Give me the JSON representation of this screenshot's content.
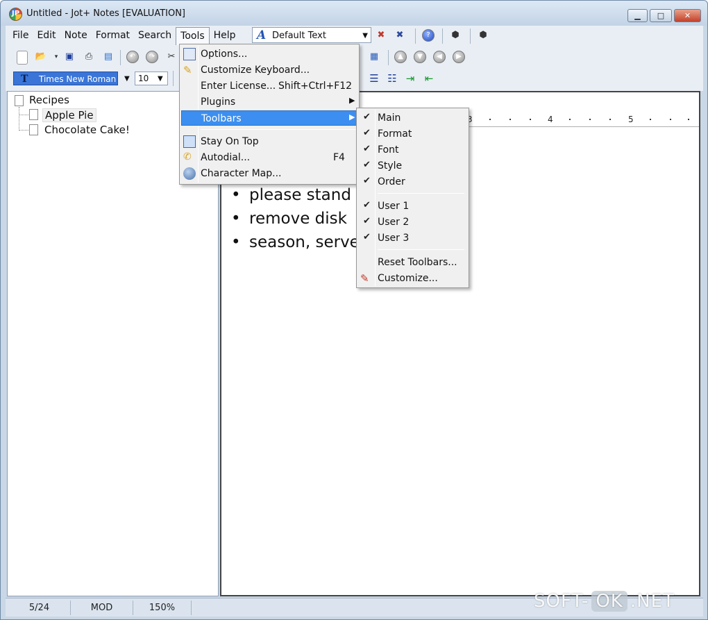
{
  "window": {
    "title": "Untitled - Jot+ Notes [EVALUATION]",
    "controls": {
      "minimize": "▁",
      "maximize": "□",
      "close": "✕"
    }
  },
  "menubar": {
    "items": [
      "File",
      "Edit",
      "Note",
      "Format",
      "Search",
      "Tools",
      "Help"
    ],
    "active": "Tools"
  },
  "style_combo": {
    "value": "Default Text"
  },
  "font_toolbar": {
    "font_name": "Times New Roman",
    "font_size": "10"
  },
  "tree": {
    "items": [
      {
        "label": "Recipes",
        "level": 0
      },
      {
        "label": "Apple Pie",
        "level": 1
      },
      {
        "label": "Chocolate Cake!",
        "level": 1
      }
    ]
  },
  "editor": {
    "ruler_numbers": [
      "3",
      "4",
      "5"
    ],
    "bullets": [
      "please stand by",
      "remove disk",
      "season, serve a"
    ]
  },
  "tools_menu": {
    "items": [
      {
        "label": "Options...",
        "shortcut": "",
        "icon": "options-icon"
      },
      {
        "label": "Customize Keyboard...",
        "shortcut": "",
        "icon": "keyboard-pen-icon"
      },
      {
        "label": "Enter License...",
        "shortcut": "Shift+Ctrl+F12",
        "icon": ""
      },
      {
        "label": "Plugins",
        "shortcut": "",
        "icon": "",
        "submenu": true
      },
      {
        "label": "Toolbars",
        "shortcut": "",
        "icon": "",
        "submenu": true,
        "highlighted": true
      },
      {
        "label": "Stay On Top",
        "shortcut": "",
        "icon": "window-stack-icon"
      },
      {
        "label": "Autodial...",
        "shortcut": "F4",
        "icon": "phone-icon"
      },
      {
        "label": "Character Map...",
        "shortcut": "",
        "icon": "character-map-icon"
      }
    ]
  },
  "toolbars_submenu": {
    "items": [
      {
        "label": "Main",
        "checked": true
      },
      {
        "label": "Format",
        "checked": true
      },
      {
        "label": "Font",
        "checked": true
      },
      {
        "label": "Style",
        "checked": true
      },
      {
        "label": "Order",
        "checked": true
      },
      {
        "label": "User 1",
        "checked": true
      },
      {
        "label": "User 2",
        "checked": true
      },
      {
        "label": "User 3",
        "checked": true
      },
      {
        "label": "Reset Toolbars...",
        "checked": false
      },
      {
        "label": "Customize...",
        "checked": false,
        "icon": "customize-icon"
      }
    ]
  },
  "statusbar": {
    "position": "5/24",
    "mode": "MOD",
    "zoom": "150%"
  },
  "watermark": {
    "part1": "SOFT-",
    "part2": "OK",
    "part3": ".NET"
  },
  "colors": {
    "highlight": "#3c8ff0",
    "font_selection": "#3a75d7"
  }
}
